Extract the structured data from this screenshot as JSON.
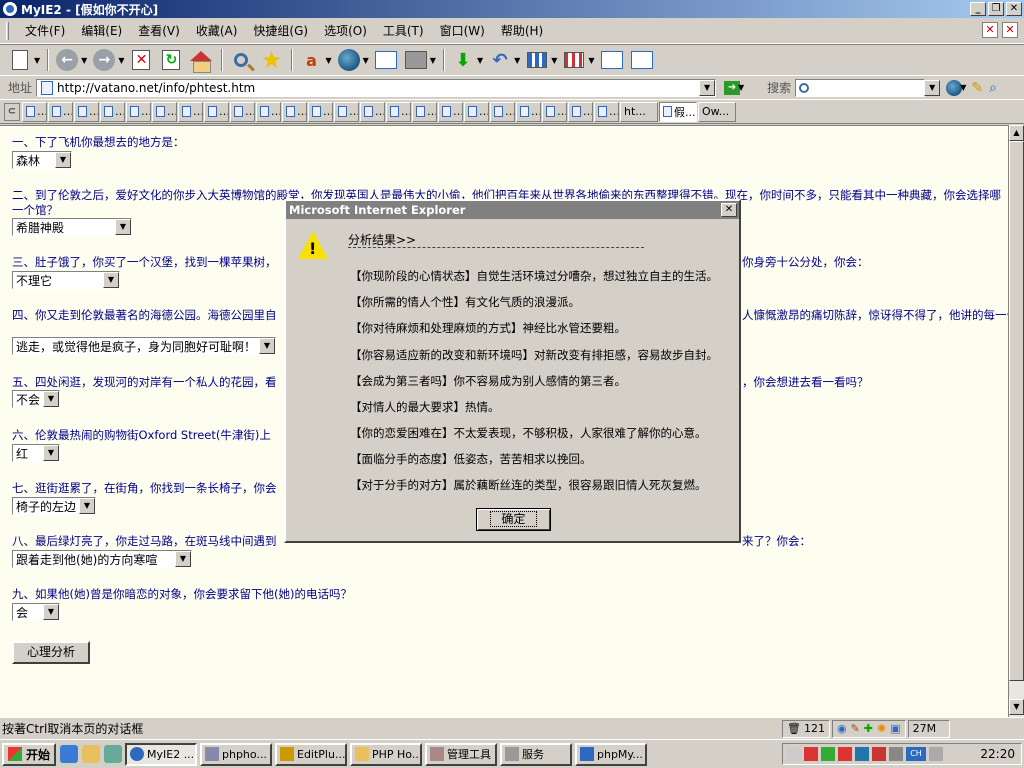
{
  "window": {
    "title": "MyIE2 - [假如你不开心]"
  },
  "menu": [
    "文件(F)",
    "编辑(E)",
    "查看(V)",
    "收藏(A)",
    "快捷组(G)",
    "选项(O)",
    "工具(T)",
    "窗口(W)",
    "帮助(H)"
  ],
  "address": {
    "label": "地址",
    "url": "http://vatano.net/info/phtest.htm",
    "search_label": "搜索"
  },
  "tabs": {
    "items": [
      "ht...",
      "假...",
      "Ow..."
    ]
  },
  "questions": [
    {
      "text": "一、下了飞机你最想去的地方是：",
      "answer": "森林"
    },
    {
      "text": "二、到了伦敦之后，爱好文化的你步入大英博物馆的殿堂，你发现英国人是最伟大的小偷，他们把百年来从世界各地偷来的东西整理得不错。现在，你时间不多，只能看其中一种典藏，你会选择哪一个馆？",
      "answer": "希腊神殿"
    },
    {
      "text": "三、肚子饿了，你买了一个汉堡，找到一棵苹果树，",
      "text_end": "你身旁十公分处，你会：",
      "answer": "不理它"
    },
    {
      "text": "四、你又走到伦敦最著名的海德公园。海德公园里自",
      "text_end": "人慷慨激昂的痛切陈辞，惊讶得不得了，他讲的每一个你都听得懂，因为他讲的是中文！中国人跑到",
      "answer": "逃走，或觉得他是疯子，身为同胞好可耻啊！"
    },
    {
      "text": "五、四处闲逛，发现河的对岸有一个私人的花园，看",
      "text_end": "，你会想进去看一看吗？",
      "answer": "不会"
    },
    {
      "text": "六、伦敦最热闹的购物街Oxford Street(牛津街)上",
      "answer": "红"
    },
    {
      "text": "七、逛街逛累了，在街角，你找到一条长椅子，你会",
      "answer": "椅子的左边"
    },
    {
      "text": "八、最后绿灯亮了，你走过马路，在斑马线中间遇到",
      "text_end": "来了？你会：",
      "answer": "跟着走到他(她)的方向寒喧"
    },
    {
      "text": "九、如果他(她)曾是你暗恋的对象，你会要求留下他(她)的电话吗？",
      "answer": "会"
    }
  ],
  "analyze_button": "心理分析",
  "dialog": {
    "title": "Microsoft Internet Explorer",
    "heading": "分析结果>>",
    "lines": [
      "【你现阶段的心情状态】自觉生活环境过分嘈杂，想过独立自主的生活。",
      "【你所需的情人个性】有文化气质的浪漫派。",
      "【你对待麻烦和处理麻烦的方式】神经比水管还要粗。",
      "【你容易适应新的改变和新环境吗】对新改变有排拒感，容易故步自封。",
      "【会成为第三者吗】你不容易成为别人感情的第三者。",
      "【对情人的最大要求】热情。",
      "【你的恋爱困难在】不太爱表现，不够积极，人家很难了解你的心意。",
      "【面临分手的态度】低姿态，苦苦相求以挽回。",
      "【对于分手的对方】属於藕断丝连的类型，很容易跟旧情人死灰复燃。"
    ],
    "ok": "确定"
  },
  "status": {
    "text": "按著Ctrl取消本页的对话框",
    "count": "121",
    "memory": "27M"
  },
  "taskbar": {
    "start": "开始",
    "tasks": [
      "MyIE2 ...",
      "phpho...",
      "EditPlu...",
      "PHP Ho...",
      "管理工具",
      "服务",
      "phpMy..."
    ],
    "clock": "22:20",
    "ime": "CH"
  },
  "colors": {
    "title_active": "#0a246a",
    "question_text": "#00008b",
    "content_bg": "#fefef0"
  }
}
